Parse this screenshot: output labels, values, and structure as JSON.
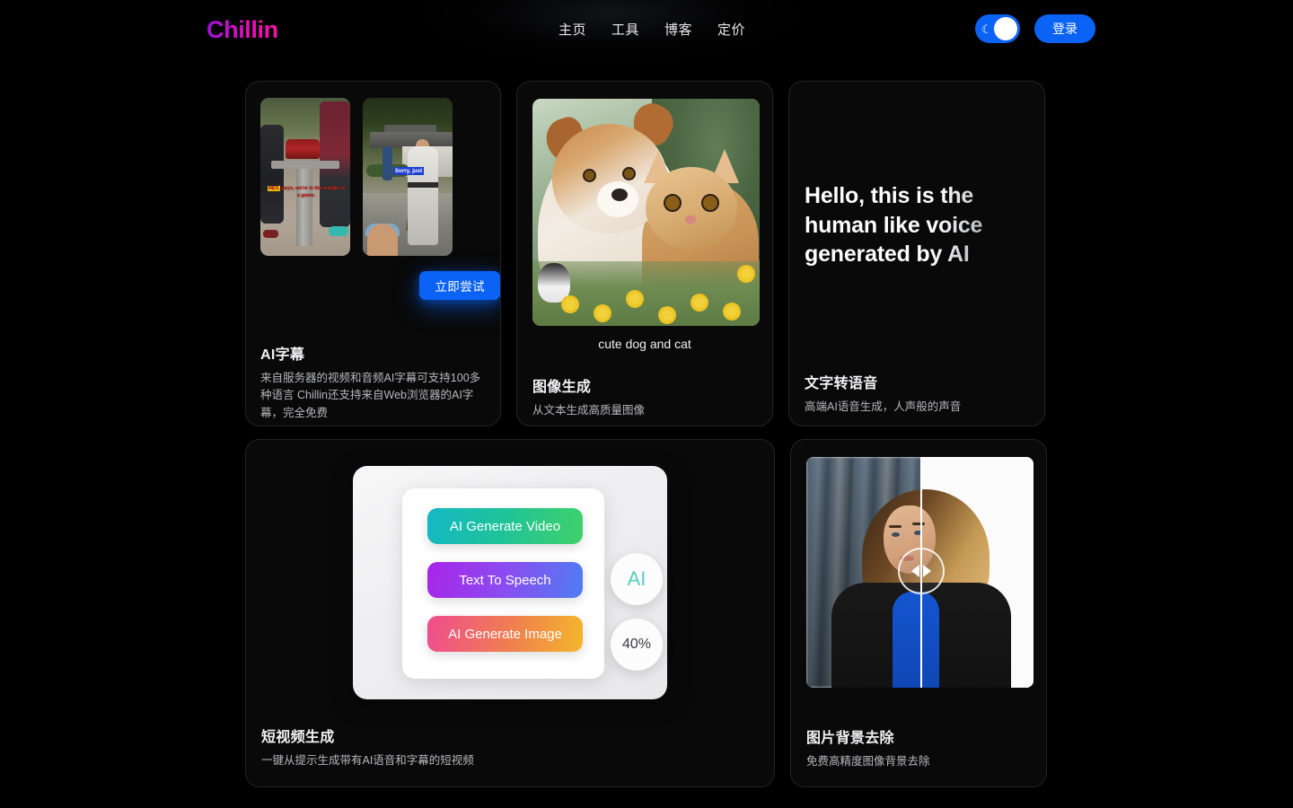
{
  "header": {
    "logo": "Chillin",
    "nav": [
      {
        "label": "主页"
      },
      {
        "label": "工具"
      },
      {
        "label": "博客"
      },
      {
        "label": "定价"
      }
    ],
    "theme_toggle": {
      "icon": "moon-icon",
      "glyph": "☾",
      "state": "on",
      "color": "#0b63f6"
    },
    "login_label": "登录"
  },
  "cards": {
    "subtitle": {
      "title": "AI字幕",
      "desc": "来自服务器的视频和音频AI字幕可支持100多种语言 Chillin还支持来自Web浏览器的AI字幕，完全免费",
      "try_label": "立即尝试",
      "thumb_1_caption_highlight": "HEY,",
      "thumb_1_caption": "guys, we're in the middle of a game.",
      "thumb_2_caption": "Sorry, just"
    },
    "imagegen": {
      "title": "图像生成",
      "desc": "从文本生成高质量图像",
      "caption": "cute dog and cat"
    },
    "tts": {
      "title": "文字转语音",
      "desc": "高端AI语音生成，人声般的声音",
      "quote": "Hello, this is the human like voice generated by AI"
    },
    "shortvideo": {
      "title": "短视频生成",
      "desc": "一键从提示生成带有AI语音和字幕的短视频",
      "buttons": [
        {
          "label": "AI Generate Video"
        },
        {
          "label": "Text To Speech"
        },
        {
          "label": "AI Generate Image"
        }
      ],
      "badge_ai": "AI",
      "badge_percent": "40%"
    },
    "bgremove": {
      "title": "图片背景去除",
      "desc": "免费高精度图像背景去除"
    }
  },
  "colors": {
    "page_bg": "#000000",
    "card_bg": "#090909",
    "card_border": "#232323",
    "accent_blue": "#0b63f6",
    "logo_gradient_start": "#9b10d8",
    "logo_gradient_end": "#f612a0",
    "text_primary": "#f2f2f4",
    "text_secondary": "#b6b7bb"
  }
}
